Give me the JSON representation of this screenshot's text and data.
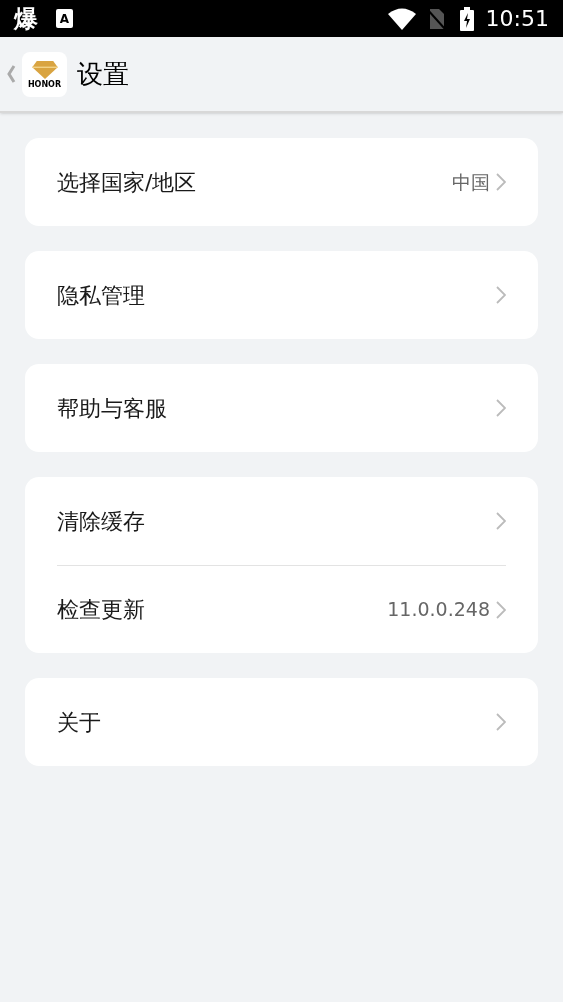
{
  "status_bar": {
    "notification_glyph": "爆",
    "keyboard_badge": "A",
    "time": "10:51"
  },
  "header": {
    "logo_text": "HONOR",
    "title": "设置"
  },
  "groups": [
    {
      "items": [
        {
          "label": "选择国家/地区",
          "value": "中国"
        }
      ]
    },
    {
      "items": [
        {
          "label": "隐私管理"
        }
      ]
    },
    {
      "items": [
        {
          "label": "帮助与客服"
        }
      ]
    },
    {
      "items": [
        {
          "label": "清除缓存"
        },
        {
          "label": "检查更新",
          "value": "11.0.0.248"
        }
      ]
    },
    {
      "items": [
        {
          "label": "关于"
        }
      ]
    }
  ]
}
